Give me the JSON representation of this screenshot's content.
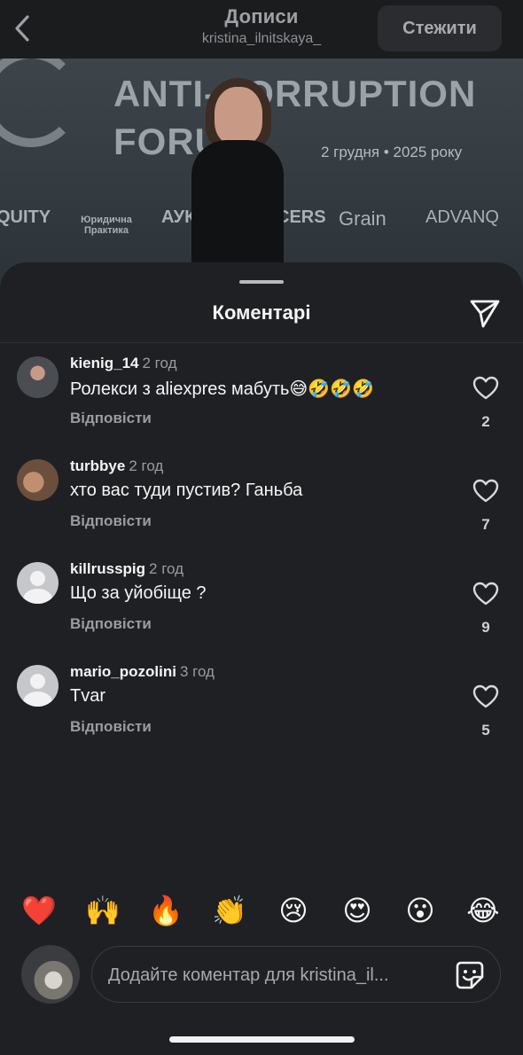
{
  "header": {
    "back_icon": "chevron-left-icon",
    "title": "Дописи",
    "subtitle": "kristina_ilnitskaya_",
    "follow_label": "Стежити"
  },
  "background_post": {
    "banner_line1": "ANTI-CORRUPTION",
    "banner_line2": "FORUM",
    "date_text": "2 грудня  •  2025 року",
    "sponsors": [
      "QUITY",
      "Юридична Практика",
      "АУК",
      "CERS",
      "Grain",
      "ADVANQ"
    ]
  },
  "comments_sheet": {
    "title": "Коментарі",
    "share_icon": "paper-plane-icon",
    "reply_label": "Відповісти",
    "comments": [
      {
        "username": "kienig_14",
        "time": "2 год",
        "text": "Ролекси з aliexpres мабуть😅🤣🤣🤣",
        "likes": "2",
        "avatar": "photo"
      },
      {
        "username": "turbbye",
        "time": "2 год",
        "text": "хто вас туди пустив? Ганьба",
        "likes": "7",
        "avatar": "photo"
      },
      {
        "username": "killrusspig",
        "time": "2 год",
        "text": "Що за уйобіще ?",
        "likes": "9",
        "avatar": "default"
      },
      {
        "username": "mario_pozolini",
        "time": "3 год",
        "text": "Tvar",
        "likes": "5",
        "avatar": "default"
      }
    ]
  },
  "emoji_bar": [
    "❤️",
    "🙌",
    "🔥",
    "👏",
    "😢",
    "😍",
    "😮",
    "😂"
  ],
  "composer": {
    "placeholder": "Додайте коментар для kristina_il...",
    "sticker_icon": "sticker-icon"
  },
  "colors": {
    "sheet_bg": "#1f2024",
    "text_primary": "#f5f5f5",
    "text_secondary": "#9a9ca2"
  }
}
